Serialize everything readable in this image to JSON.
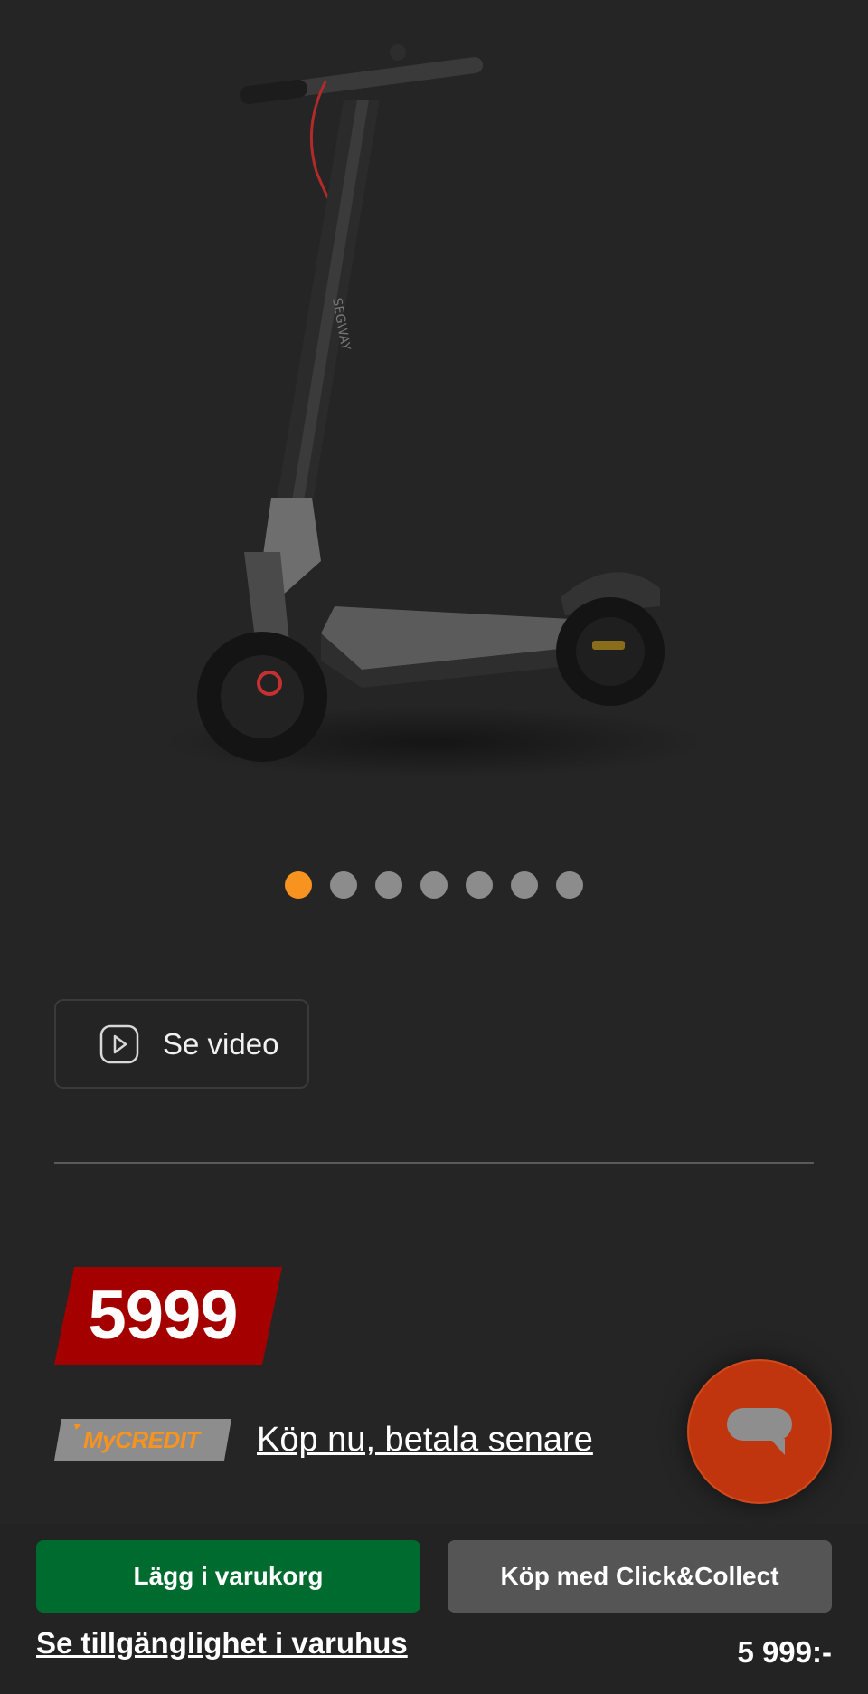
{
  "product": {
    "image_alt": "Segway electric scooter",
    "brand_mark": "SEGWAY"
  },
  "carousel": {
    "total": 7,
    "active_index": 0
  },
  "video": {
    "label": "Se video"
  },
  "price": {
    "value": "5999"
  },
  "financing": {
    "badge": "MyCREDIT",
    "link": "Köp nu, betala senare"
  },
  "actions": {
    "add_to_cart": "Lägg i varukorg",
    "click_collect": "Köp med Click&Collect",
    "availability": "Se tillgänglighet i varuhus",
    "price_summary": "5 999:-"
  },
  "colors": {
    "background": "#252525",
    "accent_orange": "#f7931e",
    "price_red": "#a50000",
    "cart_green": "#006b2f",
    "chat_orange": "#c0350e"
  }
}
